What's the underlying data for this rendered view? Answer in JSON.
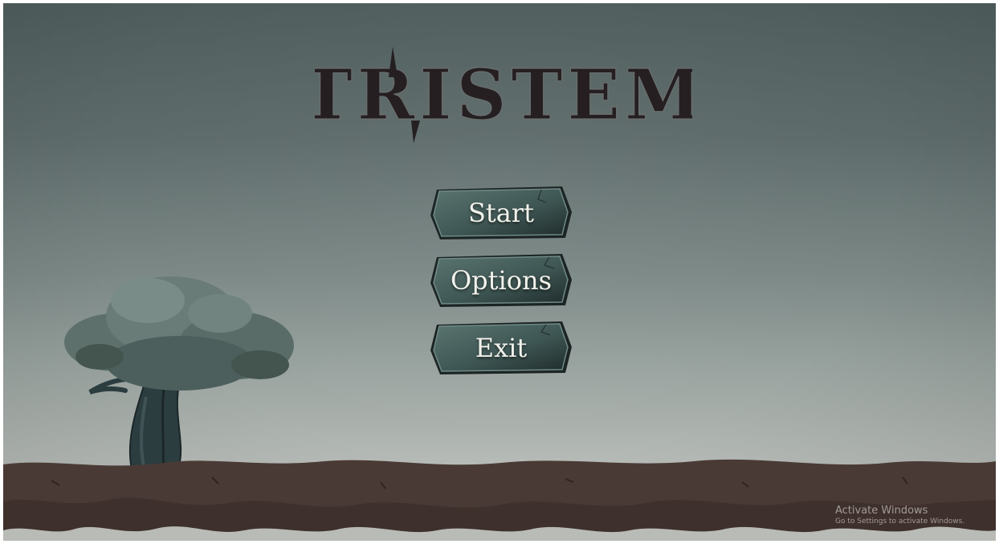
{
  "game": {
    "title": "TRISTEM"
  },
  "menu": {
    "start_label": "Start",
    "options_label": "Options",
    "exit_label": "Exit"
  },
  "watermark": {
    "title": "Activate Windows",
    "subtitle": "Go to Settings to activate Windows."
  },
  "colors": {
    "sky_top": "#4f5d5d",
    "sky_bottom": "#bdc0bc",
    "button_fill": "#3f5754",
    "button_text": "#f2f2ec",
    "title_fill": "#251f22",
    "ground": "#4a3a35",
    "tree_trunk": "#2c3d40",
    "tree_foliage": "#5e706c"
  },
  "icons": {
    "tree": "tree-icon",
    "ground": "ground-terrain"
  }
}
